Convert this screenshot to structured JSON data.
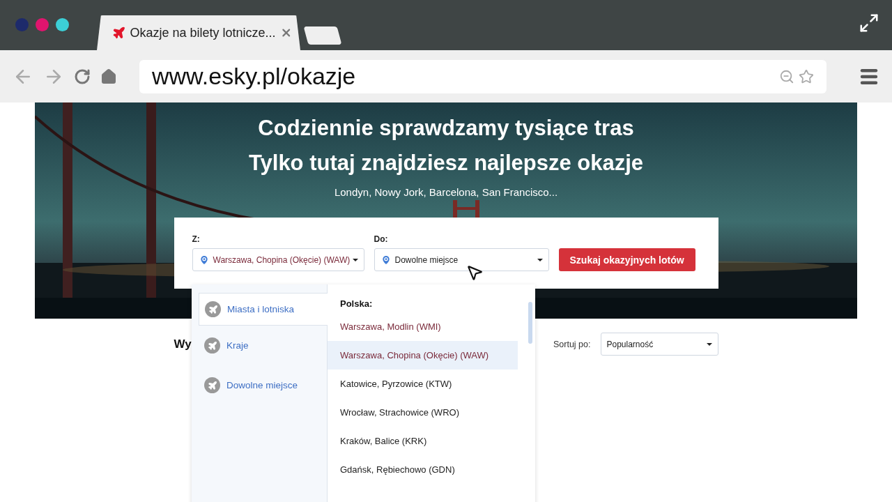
{
  "browser": {
    "window_controls": [
      {
        "color": "#1d2a6b"
      },
      {
        "color": "#e0156e"
      },
      {
        "color": "#3ccfd6"
      }
    ],
    "tab": {
      "title": "Okazje na bilety lotnicze..."
    },
    "address": "www.esky.pl/okazje"
  },
  "hero": {
    "headline": [
      "Codziennie sprawdzamy tysiące tras",
      "Tylko tutaj znajdziesz najlepsze okazje"
    ],
    "subtitle": "Londyn, Nowy Jork, Barcelona, San Francisco..."
  },
  "search": {
    "from": {
      "label": "Z:",
      "value": "Warszawa, Chopina (Okęcie) (WAW)"
    },
    "to": {
      "label": "Do:",
      "value": "Dowolne miejsce"
    },
    "button": "Szukaj okazyjnych lotów"
  },
  "results": {
    "heading": "Wy",
    "sort_label": "Sortuj po:",
    "sort_value": "Popularność"
  },
  "dropdown": {
    "categories": [
      {
        "label": "Miasta i lotniska",
        "selected": true
      },
      {
        "label": "Kraje",
        "selected": false
      },
      {
        "label": "Dowolne miejsce",
        "selected": false
      }
    ],
    "group": "Polska:",
    "options": [
      {
        "label": "Warszawa, Modlin (WMI)",
        "kind": "recent",
        "selected": false
      },
      {
        "label": "Warszawa, Chopina (Okęcie) (WAW)",
        "kind": "recent",
        "selected": true
      },
      {
        "label": "Katowice, Pyrzowice (KTW)",
        "kind": "airport",
        "selected": false
      },
      {
        "label": "Wrocław, Strachowice (WRO)",
        "kind": "airport",
        "selected": false
      },
      {
        "label": "Kraków, Balice (KRK)",
        "kind": "airport",
        "selected": false
      },
      {
        "label": "Gdańsk, Rębiechowo (GDN)",
        "kind": "airport",
        "selected": false
      }
    ]
  }
}
